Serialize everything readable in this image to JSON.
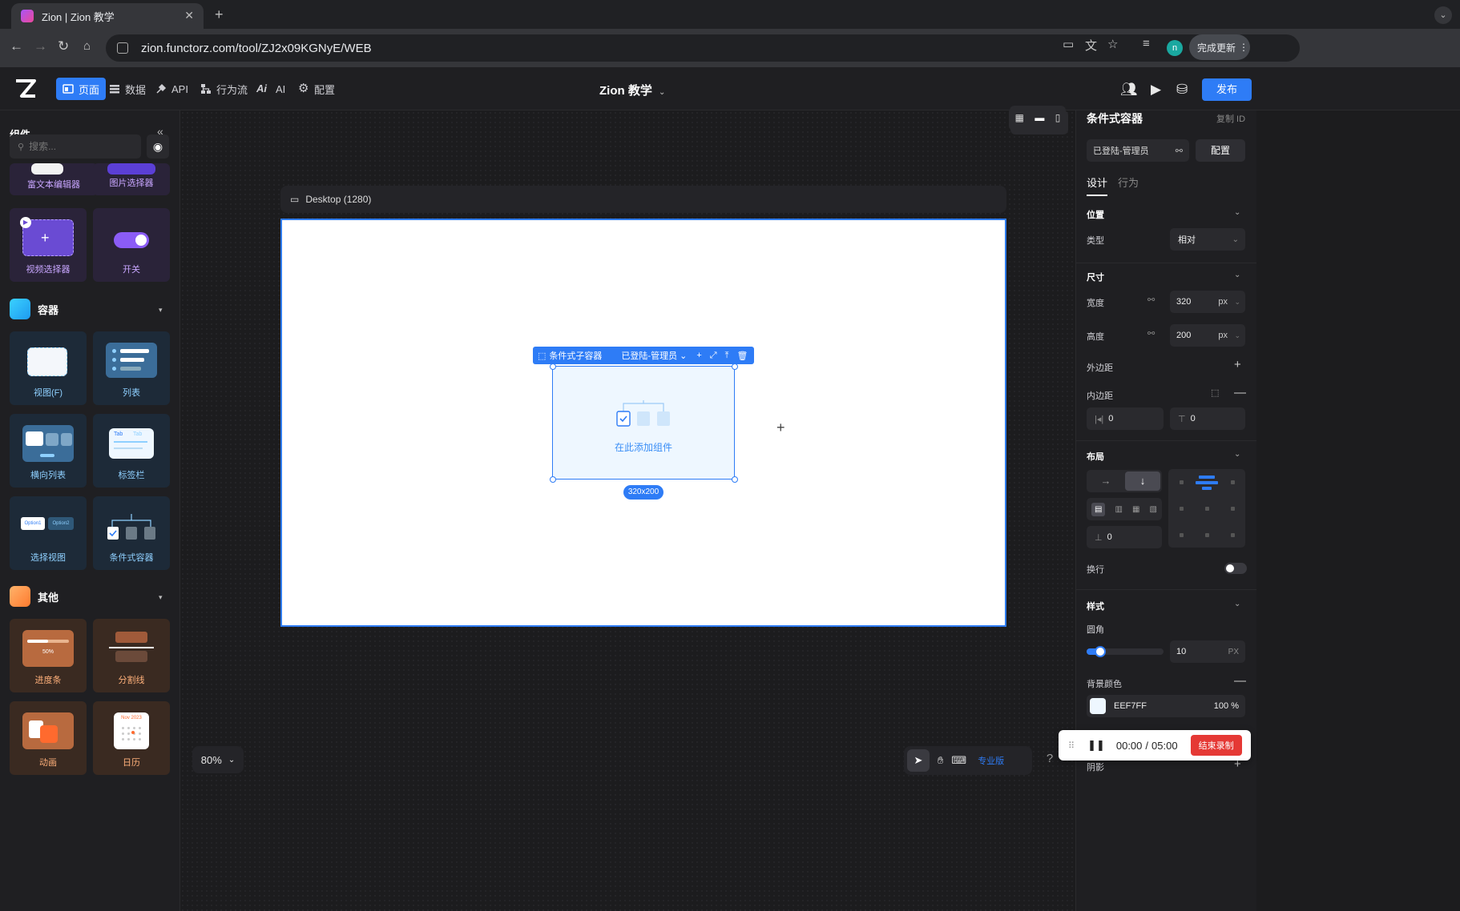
{
  "browser": {
    "tab_title": "Zion | Zion 教学",
    "url": "zion.functorz.com/tool/ZJ2x09KGNyE/WEB",
    "profile_initial": "n",
    "update_label": "完成更新"
  },
  "header": {
    "nav": [
      {
        "label": "页面",
        "icon": "page-icon",
        "active": true
      },
      {
        "label": "数据",
        "icon": "database-icon"
      },
      {
        "label": "API",
        "icon": "api-icon"
      },
      {
        "label": "行为流",
        "icon": "flow-icon"
      },
      {
        "label": "AI",
        "icon": "ai-icon"
      },
      {
        "label": "配置",
        "icon": "gear-icon"
      }
    ],
    "project_title": "Zion 教学",
    "publish_label": "发布"
  },
  "left": {
    "title": "组件",
    "search_placeholder": "搜索...",
    "cards_top": [
      {
        "label": "富文本编辑器"
      },
      {
        "label": "图片选择器"
      },
      {
        "label": "视频选择器"
      },
      {
        "label": "开关"
      }
    ],
    "section_container": "容器",
    "cards_container": [
      {
        "label": "视图(F)"
      },
      {
        "label": "列表"
      },
      {
        "label": "横向列表"
      },
      {
        "label": "标签栏"
      },
      {
        "label": "选择视图"
      },
      {
        "label": "条件式容器"
      }
    ],
    "section_other": "其他",
    "cards_other": [
      {
        "label": "进度条"
      },
      {
        "label": "分割线"
      },
      {
        "label": "动画"
      },
      {
        "label": "日历"
      }
    ],
    "ill_text": {
      "progress": "50%",
      "tab_a": "Tab",
      "tab_b": "Tab",
      "option1": "Option1",
      "option2": "Option2",
      "calendar": "Nov 2023"
    }
  },
  "canvas": {
    "device_label": "Desktop (1280)",
    "cond_toolbar_label": "条件式子容器",
    "cond_mode": "已登陆-管理员",
    "cond_hint": "在此添加组件",
    "size_badge": "320x200",
    "zoom": "80%",
    "pro_label": "专业版",
    "help": "?"
  },
  "right": {
    "title": "条件式容器",
    "copy_id": "复制 ID",
    "condition_value": "已登陆-管理员",
    "config_label": "配置",
    "tabs": [
      "设计",
      "行为"
    ],
    "position": {
      "section": "位置",
      "type_label": "类型",
      "type_value": "相对"
    },
    "size": {
      "section": "尺寸",
      "width_label": "宽度",
      "width_value": "320",
      "width_unit": "px",
      "height_label": "高度",
      "height_value": "200",
      "height_unit": "px"
    },
    "margin_label": "外边距",
    "padding": {
      "label": "内边距",
      "left_value": "0",
      "top_value": "0"
    },
    "layout": {
      "section": "布局",
      "gap_value": "0",
      "wrap_label": "换行"
    },
    "style": {
      "section": "样式",
      "radius_label": "圆角",
      "radius_value": "10",
      "radius_unit": "PX",
      "radius_fraction": 0.1,
      "bg_label": "背景颜色",
      "bg_hex": "EEF7FF",
      "bg_opacity": "100 %",
      "shadow_label": "阴影"
    }
  },
  "recorder": {
    "elapsed": "00:00",
    "separator": "/",
    "total": "05:00",
    "stop_label": "结束录制"
  },
  "colors": {
    "accent": "#2e7cf6",
    "container_bg": "#eef7ff",
    "stop": "#e53935"
  }
}
